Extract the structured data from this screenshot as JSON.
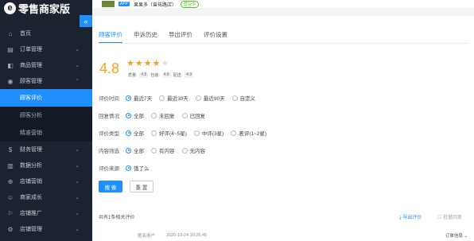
{
  "brand": {
    "logo_char": "e",
    "title": "零售商家版",
    "collapse_icon": "«"
  },
  "topbar": {
    "tag": "APP",
    "store": "果果多（曾祐路店）",
    "status": "营业中"
  },
  "menu": [
    {
      "label": "首页",
      "icon": "⌂"
    },
    {
      "label": "订单管理",
      "icon": "▤",
      "arrow": "⌄"
    },
    {
      "label": "商品管理",
      "icon": "◧",
      "arrow": "⌄"
    },
    {
      "label": "顾客管理",
      "icon": "◉",
      "arrow": "⌃"
    }
  ],
  "submenu": [
    "顾客评价",
    "顾客分析",
    "精准营销"
  ],
  "menu2": [
    {
      "label": "财务管理",
      "icon": "$",
      "arrow": "⌄"
    },
    {
      "label": "数据分析",
      "icon": "▥",
      "arrow": "⌄"
    },
    {
      "label": "店铺营销",
      "icon": "⊕",
      "arrow": "⌄"
    },
    {
      "label": "商家成长",
      "icon": "☺",
      "arrow": "⌄"
    },
    {
      "label": "店铺推广",
      "icon": "⚐",
      "arrow": "⌄"
    },
    {
      "label": "店铺管理",
      "icon": "⚙",
      "arrow": "⌄"
    }
  ],
  "tabs": [
    "顾客评价",
    "申诉历史",
    "导出评价",
    "评价设置"
  ],
  "score": {
    "value": "4.8",
    "stars": 4,
    "sub": [
      {
        "label": "质量:",
        "value": "4.8"
      },
      {
        "label": "包装:",
        "value": "4.8"
      },
      {
        "label": "配送:",
        "value": "4.9"
      }
    ]
  },
  "filters": [
    {
      "label": "评价时间",
      "options": [
        "最近7天",
        "最近30天",
        "最近90天",
        "自定义"
      ]
    },
    {
      "label": "回复情况",
      "options": [
        "全部",
        "未回复",
        "已回复"
      ]
    },
    {
      "label": "评价类型",
      "options": [
        "全部",
        "好评(4~5星)",
        "中评(3星)",
        "差评(1~2星)"
      ]
    },
    {
      "label": "内容筛选",
      "options": [
        "全部",
        "有内容",
        "无内容"
      ]
    },
    {
      "label": "评价来源",
      "options": [
        "饿了么"
      ]
    }
  ],
  "buttons": {
    "search": "搜 索",
    "reset": "重 置"
  },
  "footer": {
    "count": "共有1条相关评价",
    "export": "⤓ 导出评价",
    "batch": "☐ 批量回复"
  },
  "bottom": {
    "user": "匿名用户",
    "time": "2020-10-24 10:26:45",
    "order": "订单信息 ⌄"
  }
}
